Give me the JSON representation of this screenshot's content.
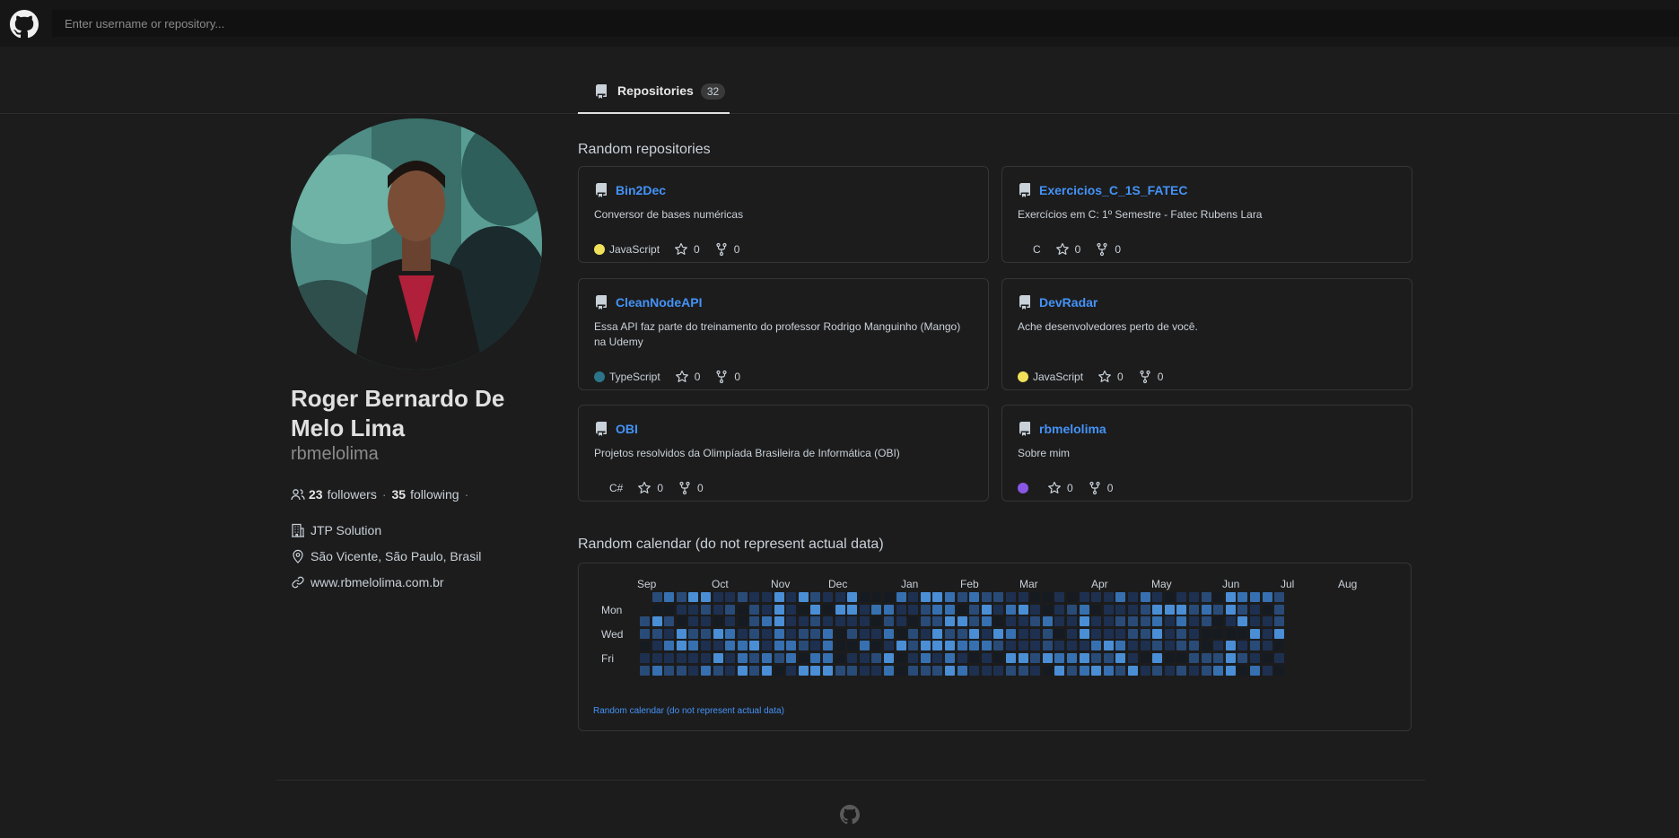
{
  "search": {
    "placeholder": "Enter username or repository..."
  },
  "tabs": [
    {
      "label": "Repositories",
      "count": "32",
      "icon": "repo-icon"
    }
  ],
  "profile": {
    "name": "Roger Bernardo De Melo Lima",
    "login": "rbmelolima",
    "followers_count": "23",
    "followers_label": "followers",
    "following_count": "35",
    "following_label": "following",
    "company": "JTP Solution",
    "location": "São Vicente, São Paulo, Brasil",
    "website": "www.rbmelolima.com.br"
  },
  "repos_section": {
    "title": "Random repositories"
  },
  "repos": [
    {
      "name": "Bin2Dec",
      "description": "Conversor de bases numéricas",
      "language": "JavaScript",
      "lang_color": "#f1e05a",
      "stars": "0",
      "forks": "0"
    },
    {
      "name": "Exercicios_C_1S_FATEC",
      "description": "Exercícios em C: 1º Semestre - Fatec Rubens Lara",
      "language": "C",
      "lang_color": "",
      "stars": "0",
      "forks": "0"
    },
    {
      "name": "CleanNodeAPI",
      "description": "Essa API faz parte do treinamento do professor Rodrigo Manguinho (Mango) na Udemy",
      "language": "TypeScript",
      "lang_color": "#2b7489",
      "stars": "0",
      "forks": "0"
    },
    {
      "name": "DevRadar",
      "description": "Ache desenvolvedores perto de você.",
      "language": "JavaScript",
      "lang_color": "#f1e05a",
      "stars": "0",
      "forks": "0"
    },
    {
      "name": "OBI",
      "description": "Projetos resolvidos da Olimpíada Brasileira de Informática (OBI)",
      "language": "C#",
      "lang_color": "",
      "stars": "0",
      "forks": "0"
    },
    {
      "name": "rbmelolima",
      "description": "Sobre mim",
      "language": "",
      "lang_color": "#8957e5",
      "stars": "0",
      "forks": "0"
    }
  ],
  "calendar": {
    "title": "Random calendar (do not represent actual data)",
    "months": [
      "Sep",
      "Oct",
      "Nov",
      "Dec",
      "Jan",
      "Feb",
      "Mar",
      "Apr",
      "May",
      "Jun",
      "Jul",
      "Aug"
    ],
    "days": [
      "Mon",
      "Wed",
      "Fri"
    ],
    "footer": "Random calendar (do not represent actual data)",
    "colors": [
      "#161b22",
      "#1e3050",
      "#294b78",
      "#3670b0",
      "#4a8ed6"
    ]
  },
  "colors": {
    "link": "#4493f8",
    "background": "#1c1c1c",
    "header": "#161616"
  }
}
